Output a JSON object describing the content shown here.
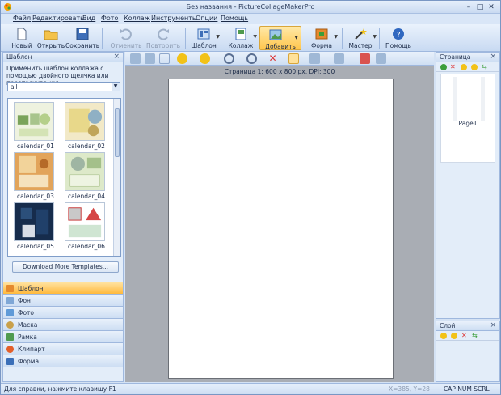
{
  "window": {
    "title": "Без названия - PictureCollageMakerPro",
    "minimize_label": "–",
    "maximize_label": "□",
    "close_label": "✕"
  },
  "menu": [
    "Файл",
    "Редактировать",
    "Вид",
    "Фото",
    "Коллаж",
    "Инструменты",
    "Опции",
    "Помощь"
  ],
  "toolbar": {
    "new": "Новый",
    "open": "Открыть",
    "save": "Сохранить",
    "undo": "Отменить",
    "redo": "Повторить",
    "template": "Шаблон",
    "collage": "Коллаж",
    "add": "Добавить",
    "shape": "Форма",
    "wizard": "Мастер",
    "help": "Помощь"
  },
  "template_panel": {
    "title": "Шаблон",
    "hint": "Применить шаблон коллажа с помощью двойного щелчка или перетаскивания",
    "filter_value": "all",
    "templates": [
      "calendar_01",
      "calendar_02",
      "calendar_03",
      "calendar_04",
      "calendar_05",
      "calendar_06"
    ],
    "download_button": "Download More Templates..."
  },
  "nav": {
    "items": [
      "Шаблон",
      "Фон",
      "Фото",
      "Маска",
      "Рамка",
      "Клипарт",
      "Форма"
    ],
    "selected": "Шаблон"
  },
  "canvas": {
    "page_info": "Страница 1: 600 x 800 px, DPI: 300"
  },
  "pages_panel": {
    "title": "Страница",
    "thumb_label": "Page1"
  },
  "layers_panel": {
    "title": "Слой"
  },
  "status": {
    "help_text": "Для справки, нажмите клавишу F1",
    "coords": "X=385, Y=28",
    "indicators": "CAP NUM SCRL"
  },
  "colors": {
    "accent": "#ffb93c",
    "chrome": "#d4e2f4",
    "workspace": "#a9adb4"
  }
}
